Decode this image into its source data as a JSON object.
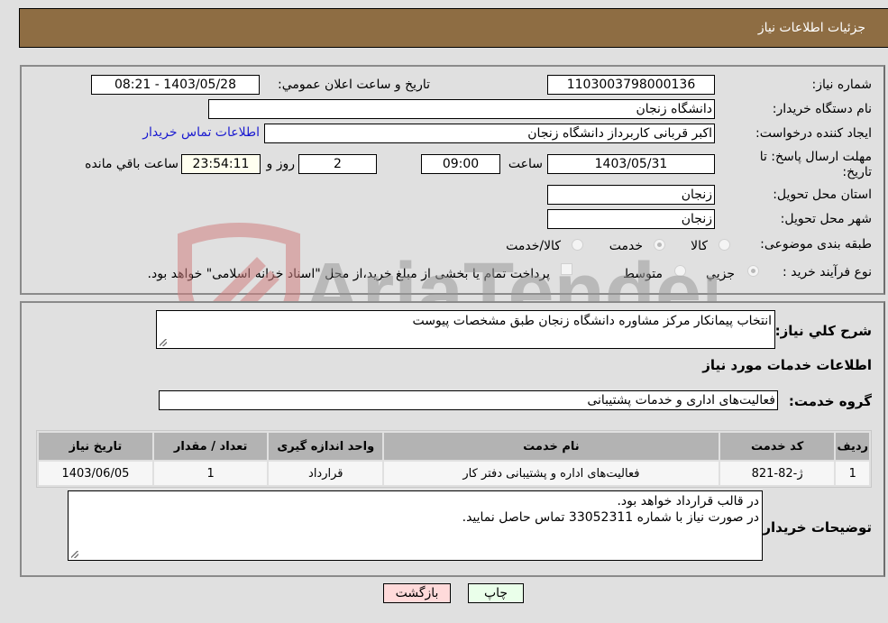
{
  "header": {
    "title": "جزئیات اطلاعات نیاز"
  },
  "form": {
    "need_number": {
      "label": "شماره نیاز:",
      "value": "1103003798000136"
    },
    "announce": {
      "label": "تاریخ و ساعت اعلان عمومي:",
      "value": "1403/05/28 - 08:21"
    },
    "buyer_org": {
      "label": "نام دستگاه خريدار:",
      "value": "دانشگاه زنجان"
    },
    "requester": {
      "label": "ایجاد کننده درخواست:",
      "value": "اکبر قربانی کاربرداز دانشگاه زنجان"
    },
    "buyer_contact_link": "اطلاعات تماس خريدار",
    "deadline": {
      "label_line1": "مهلت ارسال پاسخ: تا",
      "label_line2": "تاریخ:",
      "date": "1403/05/31",
      "time_label": "ساعت",
      "time": "09:00",
      "days": "2",
      "days_label": "روز و",
      "remaining": "23:54:11",
      "remaining_label": "ساعت باقي مانده"
    },
    "province": {
      "label": "استان محل تحویل:",
      "value": "زنجان"
    },
    "city": {
      "label": "شهر محل تحویل:",
      "value": "زنجان"
    },
    "category": {
      "label": "طبقه بندی موضوعی:",
      "options": [
        {
          "label": "کالا",
          "checked": false
        },
        {
          "label": "خدمت",
          "checked": true
        },
        {
          "label": "کالا/خدمت",
          "checked": false
        }
      ]
    },
    "process": {
      "label": "نوع فرآیند خرید :",
      "options": [
        {
          "label": "جزيي",
          "checked": true
        },
        {
          "label": "متوسط",
          "checked": false
        }
      ],
      "treasury_checkbox_label": "پرداخت تمام یا بخشی از مبلغ خرید،از محل \"اسناد خزانه اسلامی\" خواهد بود."
    }
  },
  "details": {
    "summary_label": "شرح كلي نياز:",
    "summary_value": "انتخاب پیمانکار مرکز مشاوره دانشگاه زنجان طبق مشخصات پیوست",
    "services_heading": "اطلاعات خدمات مورد نیاز",
    "service_group_label": "گروه خدمت:",
    "service_group_value": "فعالیت‌های اداری و خدمات پشتیبانی",
    "table": {
      "headers": [
        "ردیف",
        "کد خدمت",
        "نام خدمت",
        "واحد اندازه گیری",
        "تعداد / مقدار",
        "تاریخ نیاز"
      ],
      "rows": [
        [
          "1",
          "ژ-82-821",
          "فعالیت‌های اداره و پشتیبانی دفتر کار",
          "قرارداد",
          "1",
          "1403/06/05"
        ]
      ]
    },
    "buyer_notes_label": "توضیحات خریدار:",
    "buyer_notes_line1": "در قالب قرارداد خواهد بود.",
    "buyer_notes_line2": "در صورت نیاز با شماره 33052311 تماس حاصل نمایید."
  },
  "buttons": {
    "print": "چاپ",
    "back": "بازگشت"
  },
  "watermark": {
    "text": "AriaTender.neT"
  },
  "colors": {
    "header_bg": "#8e6d43",
    "print_bg": "#eaffea",
    "back_bg": "#ffdada",
    "link": "#1a1ad0"
  }
}
